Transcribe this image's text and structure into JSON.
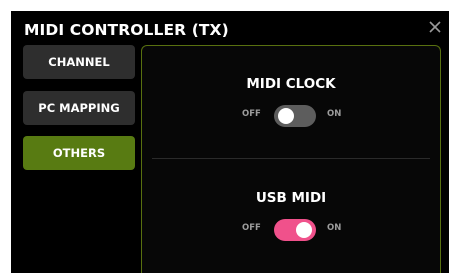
{
  "dialog": {
    "title": "MIDI CONTROLLER (TX)",
    "close_icon": "close-icon"
  },
  "nav": {
    "items": [
      {
        "label": "CHANNEL",
        "active": false
      },
      {
        "label": "PC MAPPING",
        "active": false
      },
      {
        "label": "OTHERS",
        "active": true
      }
    ]
  },
  "settings": {
    "midi_clock": {
      "title": "MIDI CLOCK",
      "off_label": "OFF",
      "on_label": "ON",
      "enabled": false
    },
    "usb_midi": {
      "title": "USB MIDI",
      "off_label": "OFF",
      "on_label": "ON",
      "enabled": true
    }
  },
  "colors": {
    "active_nav": "#587b12",
    "toggle_on": "#f0518b",
    "toggle_off": "#5d5d5d"
  }
}
